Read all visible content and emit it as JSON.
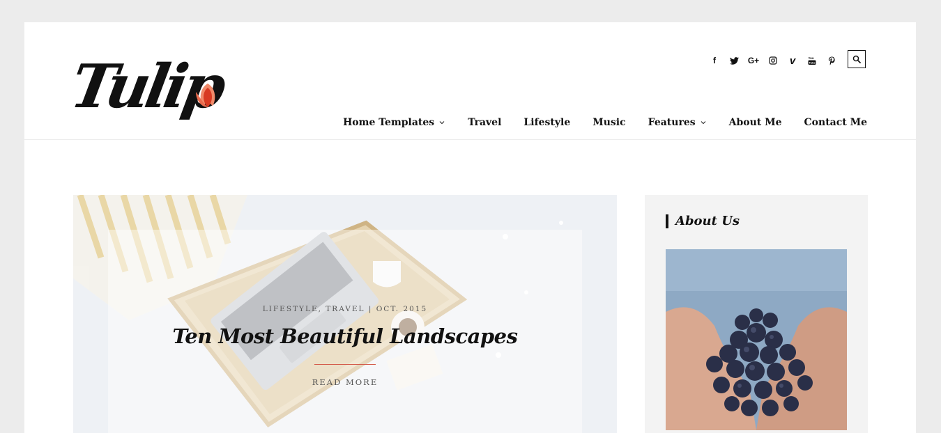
{
  "site": {
    "logo_text": "Tulip",
    "accent_color": "#e0533b"
  },
  "header": {
    "social_icons": [
      {
        "name": "facebook-icon",
        "glyph": "f"
      },
      {
        "name": "twitter-icon",
        "glyph": "🐦"
      },
      {
        "name": "google-plus-icon",
        "glyph": "G+"
      },
      {
        "name": "instagram-icon",
        "glyph": "◎"
      },
      {
        "name": "vimeo-icon",
        "glyph": "v"
      },
      {
        "name": "youtube-icon",
        "glyph": "You"
      },
      {
        "name": "pinterest-icon",
        "glyph": "℗"
      }
    ],
    "search_icon": "search-icon"
  },
  "nav": {
    "items": [
      {
        "label": "Home Templates",
        "dropdown": true
      },
      {
        "label": "Travel",
        "dropdown": false
      },
      {
        "label": "Lifestyle",
        "dropdown": false
      },
      {
        "label": "Music",
        "dropdown": false
      },
      {
        "label": "Features",
        "dropdown": true
      },
      {
        "label": "About Me",
        "dropdown": false
      },
      {
        "label": "Contact Me",
        "dropdown": false
      }
    ]
  },
  "featured_post": {
    "meta": "LIFESTYLE, TRAVEL | OCT. 2015",
    "title": "Ten Most Beautiful Landscapes",
    "read_more": "READ MORE"
  },
  "sidebar": {
    "widget_title": "About Us"
  }
}
